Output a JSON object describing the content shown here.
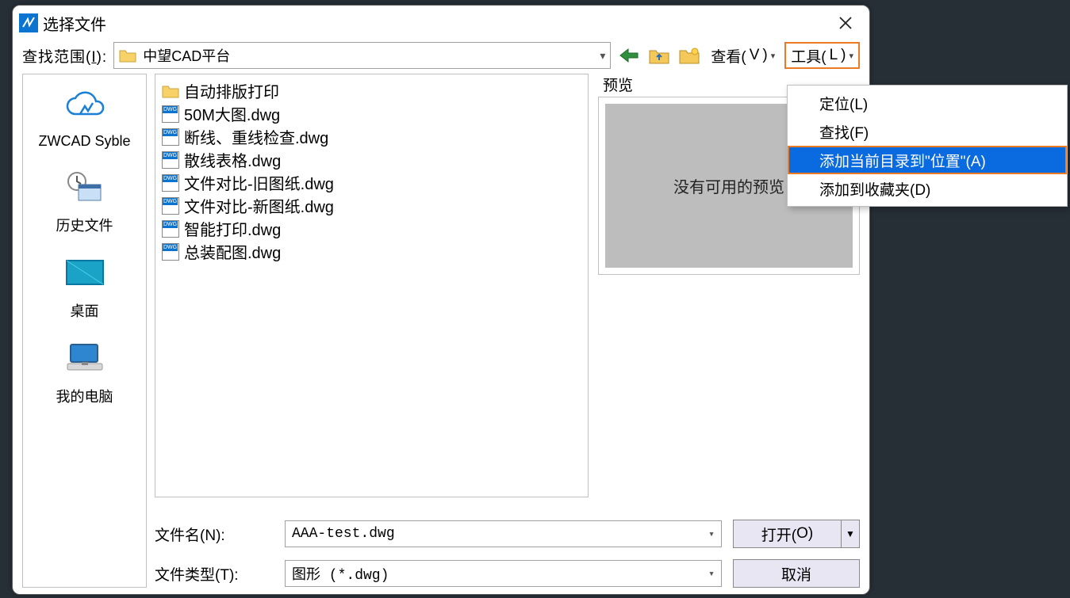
{
  "title": "选择文件",
  "toolbar": {
    "look_in_label_pre": "查找范围(",
    "look_in_label_u": "I",
    "look_in_label_post": "):",
    "path_value": "中望CAD平台",
    "view_label_pre": "查看(",
    "view_label_u": "V",
    "view_label_post": ")",
    "tools_label_pre": "工具(",
    "tools_label_u": "L",
    "tools_label_post": ")"
  },
  "places": [
    {
      "label": "ZWCAD Syble"
    },
    {
      "label": "历史文件"
    },
    {
      "label": "桌面"
    },
    {
      "label": "我的电脑"
    }
  ],
  "files": [
    {
      "type": "folder",
      "name": "自动排版打印"
    },
    {
      "type": "dwg",
      "name": "50M大图.dwg"
    },
    {
      "type": "dwg",
      "name": "断线、重线检查.dwg"
    },
    {
      "type": "dwg",
      "name": "散线表格.dwg"
    },
    {
      "type": "dwg",
      "name": "文件对比-旧图纸.dwg"
    },
    {
      "type": "dwg",
      "name": "文件对比-新图纸.dwg"
    },
    {
      "type": "dwg",
      "name": "智能打印.dwg"
    },
    {
      "type": "dwg",
      "name": "总装配图.dwg"
    }
  ],
  "preview": {
    "title": "预览",
    "empty_text": "没有可用的预览"
  },
  "bottom": {
    "filename_label_pre": "文件名(",
    "filename_label_u": "N",
    "filename_label_post": "):",
    "filename_value": "AAA-test.dwg",
    "filetype_label_pre": "文件类型(",
    "filetype_label_u": "T",
    "filetype_label_post": "):",
    "filetype_value": "图形 (*.dwg)",
    "open_label_pre": "打开(",
    "open_label_u": "O",
    "open_label_post": ")",
    "cancel_label": "取消"
  },
  "tools_menu": {
    "items": [
      {
        "label": "定位(L)",
        "selected": false
      },
      {
        "label": "查找(F)",
        "selected": false
      },
      {
        "label": "添加当前目录到\"位置\"(A)",
        "selected": true
      },
      {
        "label": "添加到收藏夹(D)",
        "selected": false
      }
    ]
  }
}
